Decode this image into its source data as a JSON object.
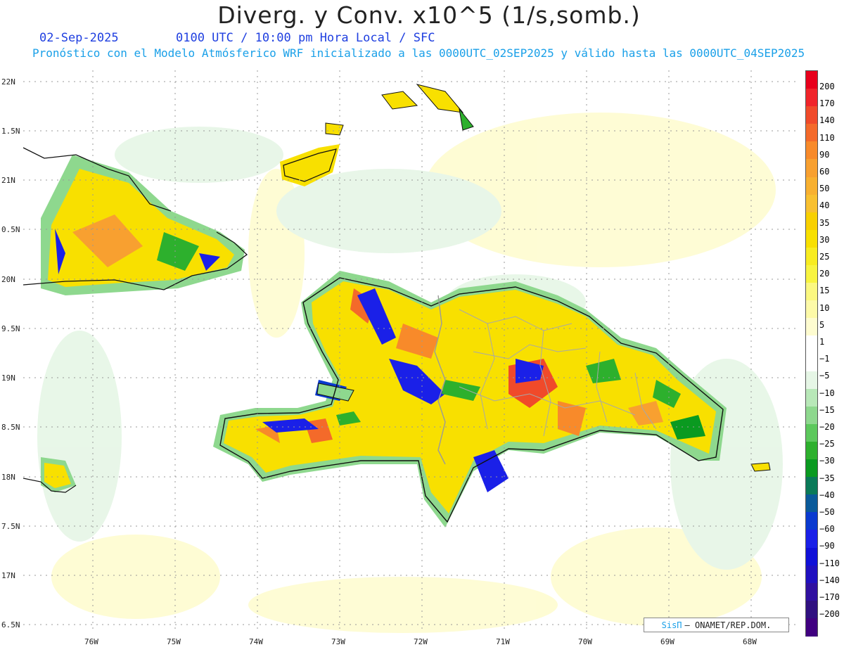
{
  "header": {
    "title": "Diverg. y Conv. x10^5 (1/s,somb.)",
    "date": "02-Sep-2025",
    "time": "0100 UTC / 10:00 pm Hora Local / SFC",
    "subtitle": "Pronóstico con el Modelo Atmósferico WRF inicializado a las 0000UTC_02SEP2025 y válido hasta las  0000UTC_04SEP2025"
  },
  "axes": {
    "lat_labels": [
      "22N",
      "1.5N",
      "21N",
      "0.5N",
      "20N",
      "9.5N",
      "19N",
      "8.5N",
      "18N",
      "7.5N",
      "17N",
      "6.5N"
    ],
    "lon_labels": [
      "76W",
      "75W",
      "74W",
      "73W",
      "72W",
      "71W",
      "70W",
      "69W",
      "68W"
    ]
  },
  "colorbar": {
    "labels": [
      "200",
      "170",
      "140",
      "110",
      "90",
      "60",
      "50",
      "40",
      "35",
      "30",
      "25",
      "20",
      "15",
      "10",
      "5",
      "1",
      "−1",
      "−5",
      "−10",
      "−15",
      "−20",
      "−25",
      "−30",
      "−35",
      "−40",
      "−50",
      "−60",
      "−90",
      "−110",
      "−140",
      "−170",
      "−200"
    ],
    "colors": [
      "#e8001c",
      "#f0242a",
      "#f04a2a",
      "#f46a2a",
      "#f88a2a",
      "#f8a030",
      "#f8b030",
      "#f8c030",
      "#f8d000",
      "#f8e000",
      "#f8ec20",
      "#f8f440",
      "#fbf880",
      "#fdfaa8",
      "#fefcd0",
      "#ffffff",
      "#ffffff",
      "#e6f6e6",
      "#b8e8b8",
      "#8ed88e",
      "#5cc85c",
      "#2db02d",
      "#0a9a20",
      "#0a7a58",
      "#0a5a9a",
      "#0a3ad0",
      "#1a20e8",
      "#1010d8",
      "#2010c0",
      "#3010a0",
      "#301080",
      "#400080"
    ]
  },
  "credit": {
    "logo": "SisΠ",
    "text": "– ONAMET/REP.DOM."
  }
}
